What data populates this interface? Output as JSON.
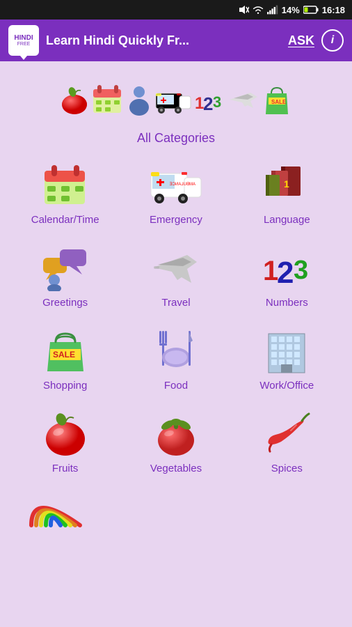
{
  "statusBar": {
    "battery": "14%",
    "time": "16:18"
  },
  "header": {
    "logoText": "HINDI",
    "logoSub": "FREE",
    "title": "Learn Hindi Quickly Fr...",
    "askLabel": "ASK",
    "infoLabel": "i"
  },
  "banner": {
    "allCategoriesLabel": "All Categories"
  },
  "categories": [
    {
      "id": "calendar-time",
      "label": "Calendar/Time",
      "emoji": "📅"
    },
    {
      "id": "emergency",
      "label": "Emergency",
      "emoji": "🚑"
    },
    {
      "id": "language",
      "label": "Language",
      "emoji": "📚"
    },
    {
      "id": "greetings",
      "label": "Greetings",
      "emoji": "💬"
    },
    {
      "id": "travel",
      "label": "Travel",
      "emoji": "✈️"
    },
    {
      "id": "numbers",
      "label": "Numbers",
      "emoji": "🔢"
    },
    {
      "id": "shopping",
      "label": "Shopping",
      "emoji": "🛍️"
    },
    {
      "id": "food",
      "label": "Food",
      "emoji": "🍽️"
    },
    {
      "id": "work-office",
      "label": "Work/Office",
      "emoji": "🏢"
    },
    {
      "id": "fruits",
      "label": "Fruits",
      "emoji": "🍎"
    },
    {
      "id": "vegetables",
      "label": "Vegetables",
      "emoji": "🍅"
    },
    {
      "id": "spices",
      "label": "Spices",
      "emoji": "🌶️"
    }
  ],
  "partialCategory": {
    "id": "colors",
    "emoji": "🌈"
  }
}
